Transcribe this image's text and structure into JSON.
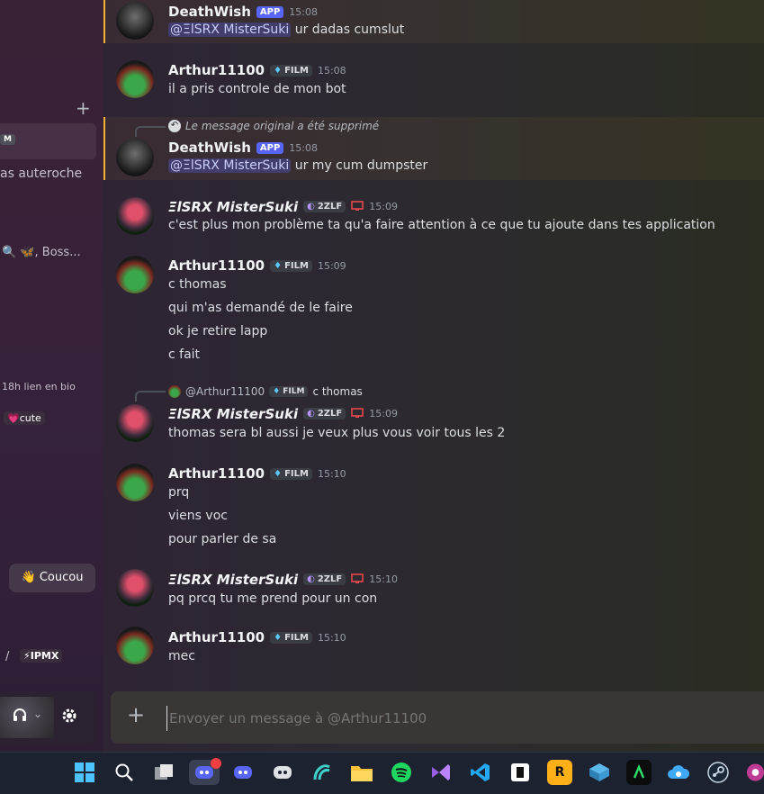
{
  "sidebar": {
    "plus_label": "+",
    "badge_text": "M",
    "item_text_1": "as auteroche",
    "item_text_2": "🔍 🦋, Boss...",
    "status_text": "18h lien en bio",
    "cute_badge": "💗cute",
    "coucou_button": "👋 Coucou",
    "ipmx_text": "⚡IPMX",
    "slash_text": "/"
  },
  "messages": [
    {
      "author": "DeathWish",
      "badge": "APP",
      "time": "15:08",
      "mention": "@ΞlSRX MisterSuki",
      "text": " ur dadas cumslut"
    },
    {
      "author": "Arthur11100",
      "tag": "FILM",
      "time": "15:08",
      "lines": [
        "il a pris controle de mon bot"
      ]
    },
    {
      "reply": "Le message original a été supprimé",
      "author": "DeathWish",
      "badge": "APP",
      "time": "15:08",
      "mention": "@ΞlSRX MisterSuki",
      "text": " ur my cum dumpster"
    },
    {
      "author": "ΞlSRX MisterSuki",
      "tag": "2ZLF",
      "time": "15:09",
      "lines": [
        "c'est plus mon problème ta qu'a faire attention à ce que tu ajoute dans tes application"
      ]
    },
    {
      "author": "Arthur11100",
      "tag": "FILM",
      "time": "15:09",
      "lines": [
        "c thomas",
        "qui m'as demandé de le faire",
        "ok je retire lapp",
        "c fait"
      ]
    },
    {
      "reply_author": "@Arthur11100",
      "reply_tag": "FILM",
      "reply_text": "c thomas",
      "author": "ΞlSRX MisterSuki",
      "tag": "2ZLF",
      "time": "15:09",
      "lines": [
        "thomas sera bl aussi je veux plus vous voir tous les 2"
      ]
    },
    {
      "author": "Arthur11100",
      "tag": "FILM",
      "time": "15:10",
      "lines": [
        "prq",
        "viens voc",
        "pour parler de sa"
      ]
    },
    {
      "author": "ΞlSRX MisterSuki",
      "tag": "2ZLF",
      "time": "15:10",
      "lines": [
        "pq prcq tu me prend pour un con"
      ]
    },
    {
      "author": "Arthur11100",
      "tag": "FILM",
      "time": "15:10",
      "lines": [
        "mec"
      ]
    }
  ],
  "composer": {
    "placeholder": "Envoyer un message à @Arthur11100",
    "plus": "+"
  },
  "taskbar": {
    "notification_count": "1"
  },
  "colors": {
    "accent": "#5865f2",
    "highlight": "#f0b132"
  }
}
